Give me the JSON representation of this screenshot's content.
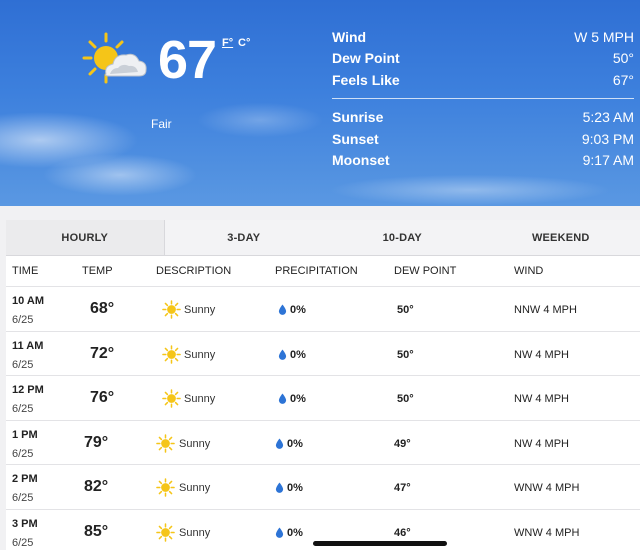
{
  "hero": {
    "temperature": "67",
    "unit_f": "F°",
    "unit_c": "C°",
    "condition": "Fair",
    "icon": "partly-sunny-icon",
    "stats": [
      {
        "label": "Wind",
        "value": "W 5 MPH"
      },
      {
        "label": "Dew Point",
        "value": "50°"
      },
      {
        "label": "Feels Like",
        "value": "67°"
      }
    ],
    "astro": [
      {
        "label": "Sunrise",
        "value": "5:23 AM"
      },
      {
        "label": "Sunset",
        "value": "9:03 PM"
      },
      {
        "label": "Moonset",
        "value": "9:17 AM"
      }
    ]
  },
  "tabs": [
    "HOURLY",
    "3-DAY",
    "10-DAY",
    "WEEKEND"
  ],
  "active_tab": "HOURLY",
  "columns": {
    "time": "TIME",
    "temp": "TEMP",
    "description": "DESCRIPTION",
    "precipitation": "PRECIPITATION",
    "dew_point": "DEW POINT",
    "wind": "WIND"
  },
  "rows": [
    {
      "time": "10 AM",
      "date": "6/25",
      "temp": "68°",
      "desc": "Sunny",
      "precip": "0%",
      "dew": "50°",
      "wind": "NNW 4 MPH"
    },
    {
      "time": "11 AM",
      "date": "6/25",
      "temp": "72°",
      "desc": "Sunny",
      "precip": "0%",
      "dew": "50°",
      "wind": "NW 4 MPH"
    },
    {
      "time": "12 PM",
      "date": "6/25",
      "temp": "76°",
      "desc": "Sunny",
      "precip": "0%",
      "dew": "50°",
      "wind": "NW 4 MPH"
    },
    {
      "time": "1 PM",
      "date": "6/25",
      "temp": "79°",
      "desc": "Sunny",
      "precip": "0%",
      "dew": "49°",
      "wind": "NW 4 MPH"
    },
    {
      "time": "2 PM",
      "date": "6/25",
      "temp": "82°",
      "desc": "Sunny",
      "precip": "0%",
      "dew": "47°",
      "wind": "WNW 4 MPH"
    },
    {
      "time": "3 PM",
      "date": "6/25",
      "temp": "85°",
      "desc": "Sunny",
      "precip": "0%",
      "dew": "46°",
      "wind": "WNW 4 MPH"
    }
  ],
  "colors": {
    "sky": "#3d80dd",
    "sun": "#f5c518",
    "rain_drop": "#2d74d6",
    "tab_bar": "#f3f3f5"
  }
}
